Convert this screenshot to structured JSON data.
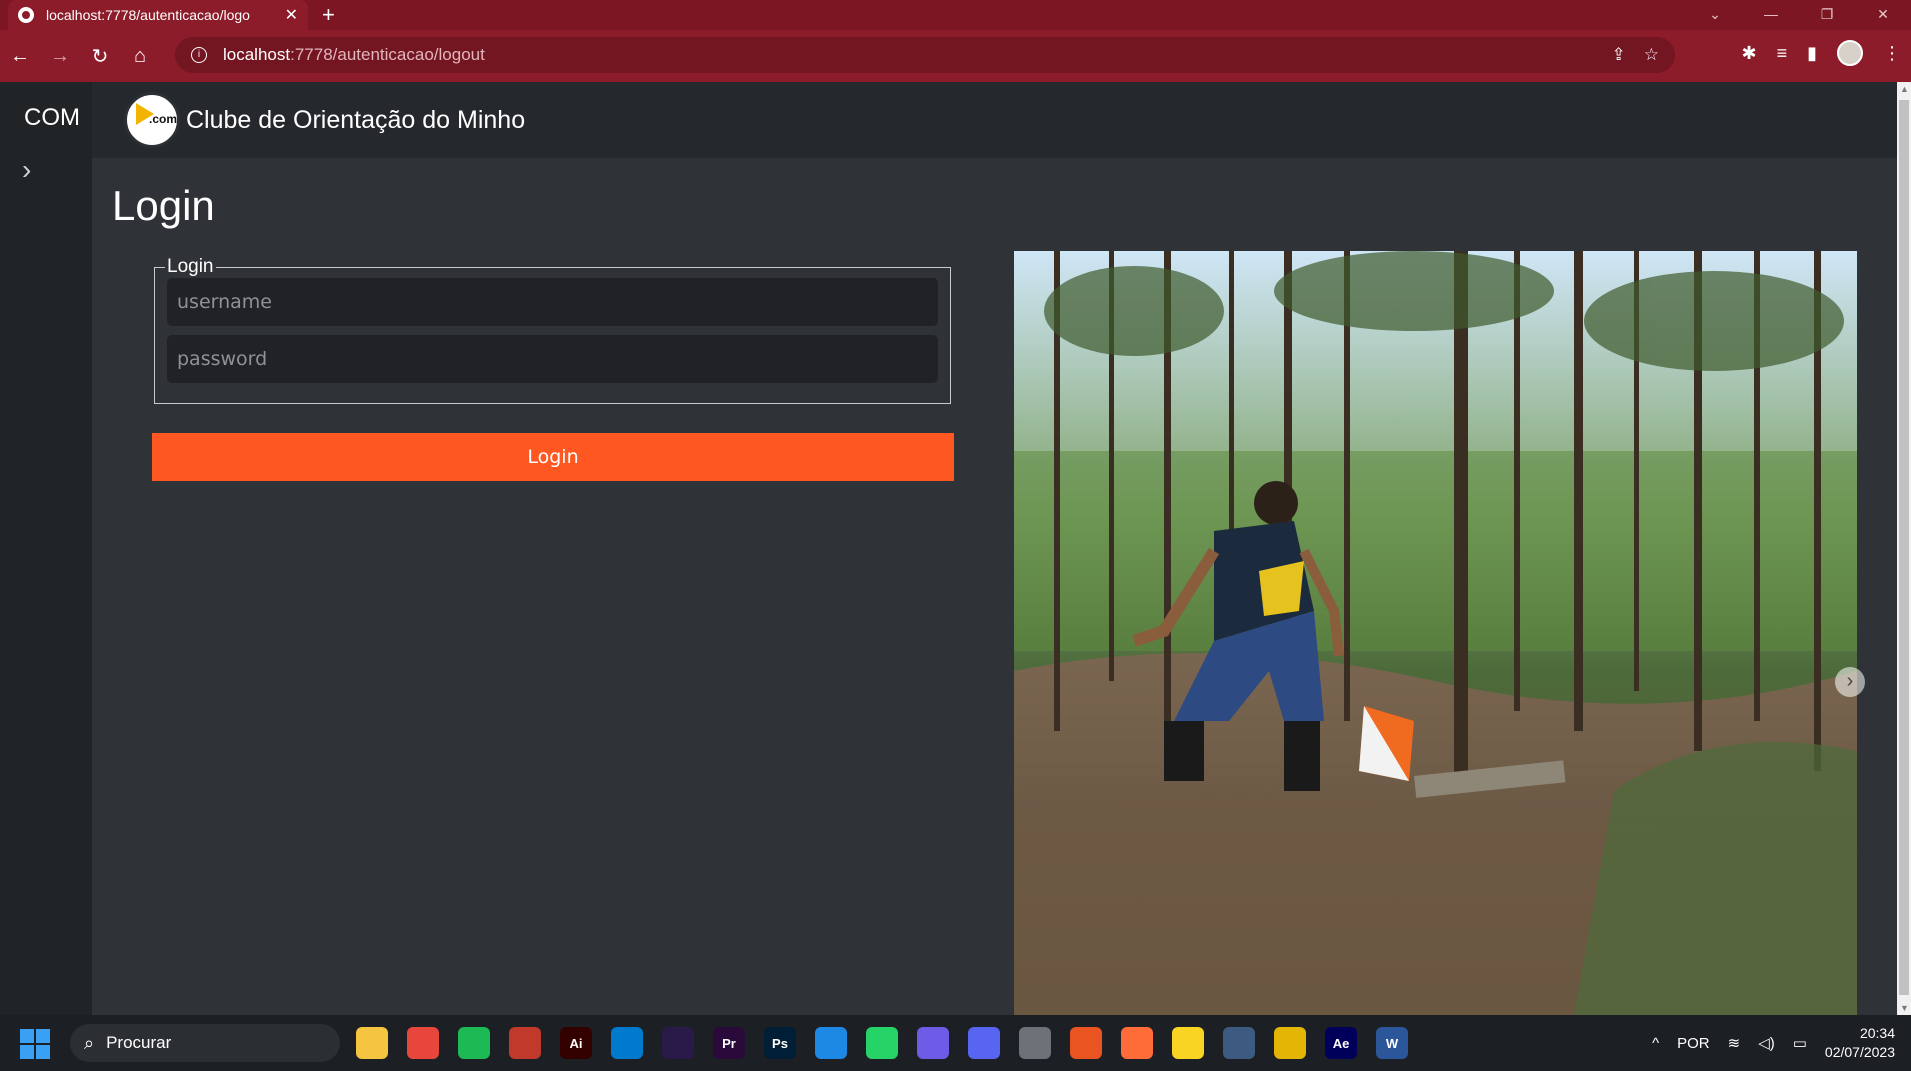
{
  "browser": {
    "tab_title": "localhost:7778/autenticacao/logo",
    "tab_close": "✕",
    "new_tab": "+",
    "url_host": "localhost",
    "url_path": ":7778/autenticacao/logout",
    "window_controls": [
      "⌄",
      "—",
      "❐",
      "✕"
    ]
  },
  "sidebar": {
    "brand": "COM",
    "toggle": "›"
  },
  "navbar": {
    "logo_text": ".com",
    "site_title": "Clube de Orientação do Minho"
  },
  "main": {
    "page_title": "Login",
    "form": {
      "legend": "Login",
      "username_placeholder": "username",
      "password_placeholder": "password",
      "submit_label": "Login"
    },
    "carousel_next": "›"
  },
  "taskbar": {
    "search_label": "Procurar",
    "apps": [
      {
        "name": "file-explorer-icon",
        "label": "",
        "color": "#f5c542"
      },
      {
        "name": "chrome-icon",
        "label": "",
        "color": "#e8453c"
      },
      {
        "name": "spotify-icon",
        "label": "",
        "color": "#1db954"
      },
      {
        "name": "app-red-icon",
        "label": "",
        "color": "#c0392b"
      },
      {
        "name": "illustrator-icon",
        "label": "Ai",
        "color": "#330000"
      },
      {
        "name": "vscode-icon",
        "label": "",
        "color": "#007acc"
      },
      {
        "name": "premiere-rush-icon",
        "label": "",
        "color": "#2a1a4a"
      },
      {
        "name": "premiere-icon",
        "label": "Pr",
        "color": "#2a0a3a"
      },
      {
        "name": "photoshop-icon",
        "label": "Ps",
        "color": "#001e36"
      },
      {
        "name": "mail-icon",
        "label": "",
        "color": "#1e88e5"
      },
      {
        "name": "whatsapp-icon",
        "label": "",
        "color": "#25d366"
      },
      {
        "name": "app-purple-icon",
        "label": "",
        "color": "#6c5ce7"
      },
      {
        "name": "discord-icon",
        "label": "",
        "color": "#5865f2"
      },
      {
        "name": "app-gray-icon",
        "label": "",
        "color": "#6d7278"
      },
      {
        "name": "ubuntu-icon",
        "label": "",
        "color": "#e95420"
      },
      {
        "name": "postman-icon",
        "label": "",
        "color": "#ff6c37"
      },
      {
        "name": "bulb-icon",
        "label": "",
        "color": "#f9d423"
      },
      {
        "name": "virtualbox-icon",
        "label": "",
        "color": "#3d5a80"
      },
      {
        "name": "app-yellow-icon",
        "label": "",
        "color": "#e3b505"
      },
      {
        "name": "after-effects-icon",
        "label": "Ae",
        "color": "#00005b"
      },
      {
        "name": "word-icon",
        "label": "W",
        "color": "#2b579a"
      }
    ],
    "tray": {
      "chevron": "^",
      "language": "POR",
      "time": "20:34",
      "date": "02/07/2023"
    }
  },
  "colors": {
    "accent": "#ff5722",
    "browser_frame": "#8c1c2a",
    "page_bg": "#2f3236"
  }
}
